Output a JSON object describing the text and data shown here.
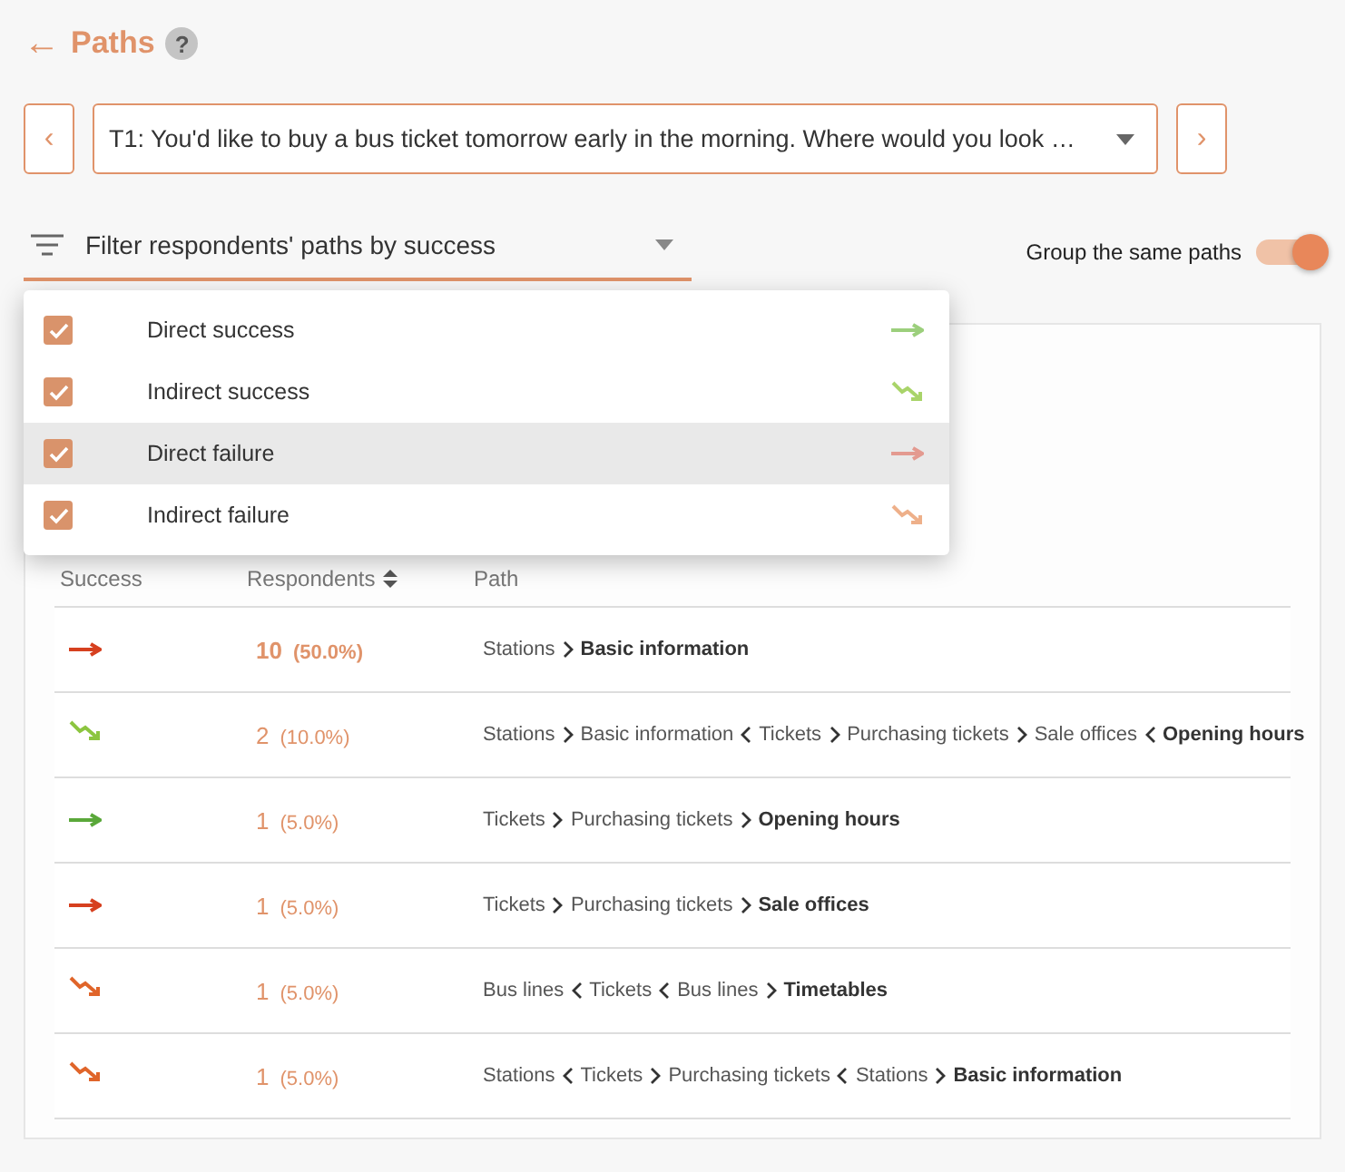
{
  "header": {
    "back": "←",
    "title": "Paths",
    "help": "?"
  },
  "task": {
    "prev": "‹",
    "value": "T1: You'd like to buy a bus ticket tomorrow early in the morning. Where would you look …",
    "next": "›"
  },
  "filter": {
    "placeholder": "Filter respondents' paths by success",
    "expanded": true,
    "options": [
      {
        "label": "Direct success",
        "kind": "direct-success",
        "checked": true,
        "selected": false
      },
      {
        "label": "Indirect success",
        "kind": "indirect-success",
        "checked": true,
        "selected": false
      },
      {
        "label": "Direct failure",
        "kind": "direct-failure",
        "checked": true,
        "selected": true
      },
      {
        "label": "Indirect failure",
        "kind": "indirect-failure",
        "checked": true,
        "selected": false
      }
    ]
  },
  "group_same_paths": {
    "label": "Group the same paths",
    "on": true
  },
  "table": {
    "columns": [
      "Success",
      "Respondents",
      "Path"
    ],
    "rows": [
      {
        "kind": "direct-failure",
        "count": "10",
        "share": "(50.0%)",
        "emphasized": true,
        "steps": [
          {
            "label": "Stations"
          },
          {
            "label": "Basic information",
            "kind": "forward"
          }
        ]
      },
      {
        "kind": "indirect-success",
        "count": "2",
        "share": "(10.0%)",
        "emphasized": false,
        "steps": [
          {
            "label": "Stations"
          },
          {
            "label": "Basic information",
            "kind": "forward"
          },
          {
            "label": "Tickets",
            "kind": "back"
          },
          {
            "label": "Purchasing tickets",
            "kind": "forward"
          },
          {
            "label": "Sale offices",
            "kind": "forward"
          },
          {
            "label": "Opening hours",
            "kind": "back"
          }
        ]
      },
      {
        "kind": "direct-success",
        "count": "1",
        "share": "(5.0%)",
        "emphasized": false,
        "steps": [
          {
            "label": "Tickets"
          },
          {
            "label": "Purchasing tickets",
            "kind": "forward"
          },
          {
            "label": "Opening hours",
            "kind": "forward"
          }
        ]
      },
      {
        "kind": "direct-failure",
        "count": "1",
        "share": "(5.0%)",
        "emphasized": false,
        "steps": [
          {
            "label": "Tickets"
          },
          {
            "label": "Purchasing tickets",
            "kind": "forward"
          },
          {
            "label": "Sale offices",
            "kind": "forward"
          }
        ]
      },
      {
        "kind": "indirect-failure",
        "count": "1",
        "share": "(5.0%)",
        "emphasized": false,
        "steps": [
          {
            "label": "Bus lines"
          },
          {
            "label": "Tickets",
            "kind": "back"
          },
          {
            "label": "Bus lines",
            "kind": "back"
          },
          {
            "label": "Timetables",
            "kind": "forward"
          }
        ]
      },
      {
        "kind": "indirect-failure",
        "count": "1",
        "share": "(5.0%)",
        "emphasized": false,
        "steps": [
          {
            "label": "Stations"
          },
          {
            "label": "Tickets",
            "kind": "back"
          },
          {
            "label": "Purchasing tickets",
            "kind": "forward"
          },
          {
            "label": "Stations",
            "kind": "back"
          },
          {
            "label": "Basic information",
            "kind": "forward"
          }
        ]
      }
    ]
  }
}
